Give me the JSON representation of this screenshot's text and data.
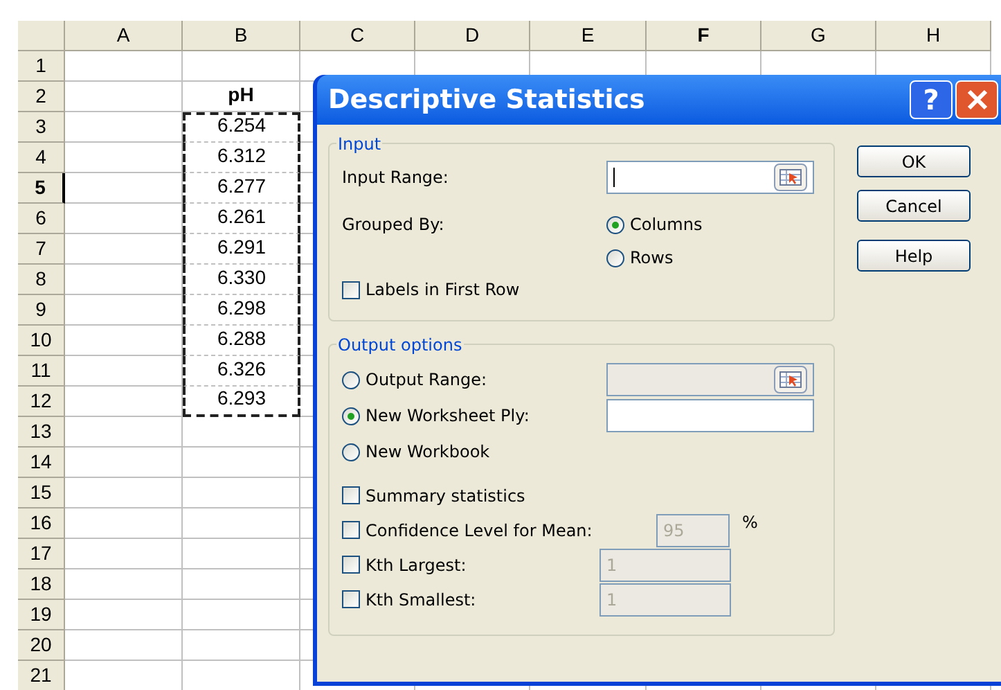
{
  "sheet": {
    "columns": [
      {
        "label": "A",
        "active": false
      },
      {
        "label": "B",
        "active": false
      },
      {
        "label": "C",
        "active": false
      },
      {
        "label": "D",
        "active": false
      },
      {
        "label": "E",
        "active": false
      },
      {
        "label": "F",
        "active": true
      },
      {
        "label": "G",
        "active": false
      },
      {
        "label": "H",
        "active": false
      }
    ],
    "rows": [
      {
        "header": "1",
        "active": false
      },
      {
        "header": "2",
        "active": false,
        "b": {
          "text": "pH",
          "kind": "heading",
          "marquee": false
        }
      },
      {
        "header": "3",
        "active": false,
        "b": {
          "text": "6.254",
          "kind": "number",
          "marquee": true
        }
      },
      {
        "header": "4",
        "active": false,
        "b": {
          "text": "6.312",
          "kind": "number",
          "marquee": true
        }
      },
      {
        "header": "5",
        "active": true,
        "b": {
          "text": "6.277",
          "kind": "number",
          "marquee": true
        }
      },
      {
        "header": "6",
        "active": false,
        "b": {
          "text": "6.261",
          "kind": "number",
          "marquee": true
        }
      },
      {
        "header": "7",
        "active": false,
        "b": {
          "text": "6.291",
          "kind": "number",
          "marquee": true
        }
      },
      {
        "header": "8",
        "active": false,
        "b": {
          "text": "6.330",
          "kind": "number",
          "marquee": true
        }
      },
      {
        "header": "9",
        "active": false,
        "b": {
          "text": "6.298",
          "kind": "number",
          "marquee": true
        }
      },
      {
        "header": "10",
        "active": false,
        "b": {
          "text": "6.288",
          "kind": "number",
          "marquee": true
        }
      },
      {
        "header": "11",
        "active": false,
        "b": {
          "text": "6.326",
          "kind": "number",
          "marquee": true
        }
      },
      {
        "header": "12",
        "active": false,
        "b": {
          "text": "6.293",
          "kind": "number",
          "marquee": true
        }
      },
      {
        "header": "13",
        "active": false
      },
      {
        "header": "14",
        "active": false
      },
      {
        "header": "15",
        "active": false
      },
      {
        "header": "16",
        "active": false
      },
      {
        "header": "17",
        "active": false
      },
      {
        "header": "18",
        "active": false
      },
      {
        "header": "19",
        "active": false
      },
      {
        "header": "20",
        "active": false
      },
      {
        "header": "21",
        "active": false
      }
    ]
  },
  "dialog": {
    "title": "Descriptive Statistics",
    "title_buttons": [
      {
        "kind": "help",
        "label": "?"
      },
      {
        "kind": "close"
      }
    ],
    "input": {
      "legend": "Input",
      "input_range": {
        "label": "Input Range:",
        "focused": true
      },
      "grouped_by": {
        "label": "Grouped By:",
        "options": [
          {
            "label": "Columns",
            "selected": true
          },
          {
            "label": "Rows",
            "selected": false
          }
        ]
      },
      "labels_in_first_row": {
        "label": "Labels in First Row",
        "checked": false
      }
    },
    "output": {
      "legend": "Output options",
      "destinations": [
        {
          "label": "Output Range:",
          "selected": false,
          "field": {
            "disabled": true,
            "picker": true
          }
        },
        {
          "label": "New Worksheet Ply:",
          "selected": true,
          "field": {
            "disabled": false,
            "picker": false
          }
        },
        {
          "label": "New Workbook",
          "selected": false
        }
      ],
      "checks": [
        {
          "label": "Summary statistics",
          "checked": false
        },
        {
          "label": "Confidence Level for Mean:",
          "checked": false,
          "field": {
            "value": "95",
            "disabled": true
          },
          "unit": "%"
        },
        {
          "label": "Kth Largest:",
          "checked": false,
          "field": {
            "value": "1",
            "disabled": true
          }
        },
        {
          "label": "Kth Smallest:",
          "checked": false,
          "field": {
            "value": "1",
            "disabled": true
          }
        }
      ]
    },
    "buttons": [
      "OK",
      "Cancel",
      "Help"
    ]
  }
}
